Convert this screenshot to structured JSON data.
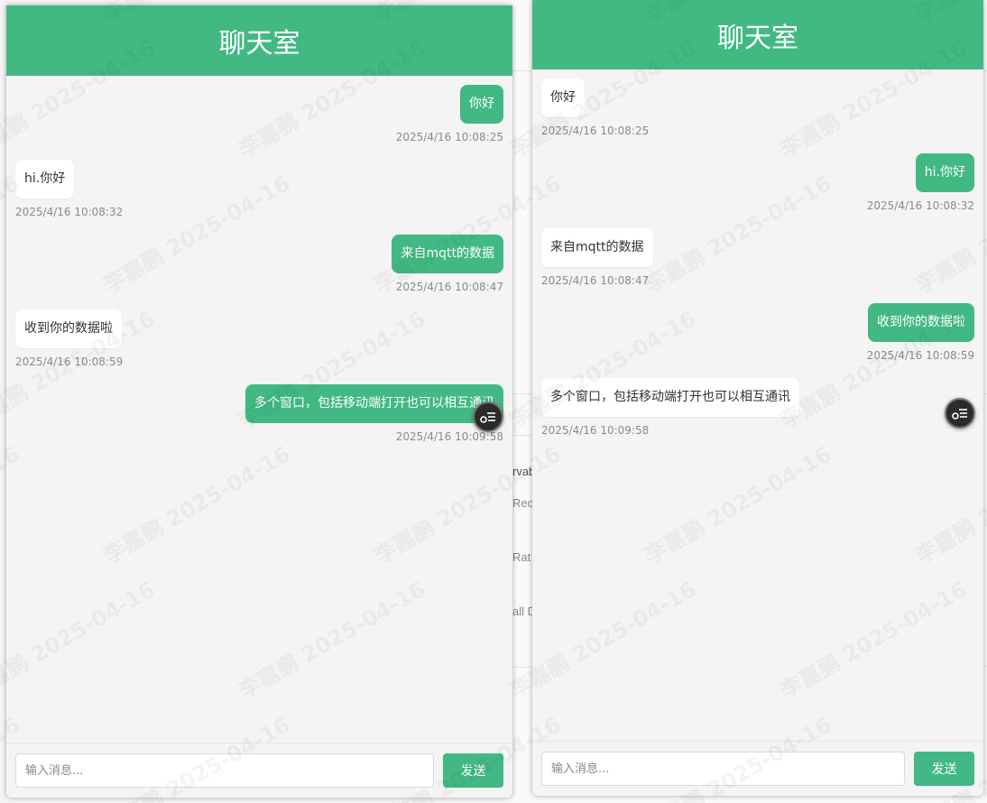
{
  "background": {
    "fragments": [
      "rvab",
      "Rec",
      "Rat",
      "all D"
    ]
  },
  "colors": {
    "accent": "#42b983",
    "received_bubble": "#ffffff",
    "chat_bg": "#f4f4f4"
  },
  "watermark": {
    "name": "李嘉鹏",
    "date": "2025-04-16"
  },
  "left_window": {
    "title": "聊天室",
    "messages": [
      {
        "direction": "sent",
        "text": "你好",
        "time": "2025/4/16 10:08:25"
      },
      {
        "direction": "received",
        "text": "hi.你好",
        "time": "2025/4/16 10:08:32"
      },
      {
        "direction": "sent",
        "text": "来自mqtt的数据",
        "time": "2025/4/16 10:08:47"
      },
      {
        "direction": "received",
        "text": "收到你的数据啦",
        "time": "2025/4/16 10:08:59"
      },
      {
        "direction": "sent",
        "text": "多个窗口，包括移动端打开也可以相互通讯",
        "time": "2025/4/16 10:09:58"
      }
    ],
    "input_placeholder": "输入消息...",
    "send_label": "发送"
  },
  "right_window": {
    "title": "聊天室",
    "messages": [
      {
        "direction": "received",
        "text": "你好",
        "time": "2025/4/16 10:08:25"
      },
      {
        "direction": "sent",
        "text": "hi.你好",
        "time": "2025/4/16 10:08:32"
      },
      {
        "direction": "received",
        "text": "来自mqtt的数据",
        "time": "2025/4/16 10:08:47"
      },
      {
        "direction": "sent",
        "text": "收到你的数据啦",
        "time": "2025/4/16 10:08:59"
      },
      {
        "direction": "received",
        "text": "多个窗口，包括移动端打开也可以相互通讯",
        "time": "2025/4/16 10:09:58"
      }
    ],
    "input_placeholder": "输入消息...",
    "send_label": "发送"
  }
}
